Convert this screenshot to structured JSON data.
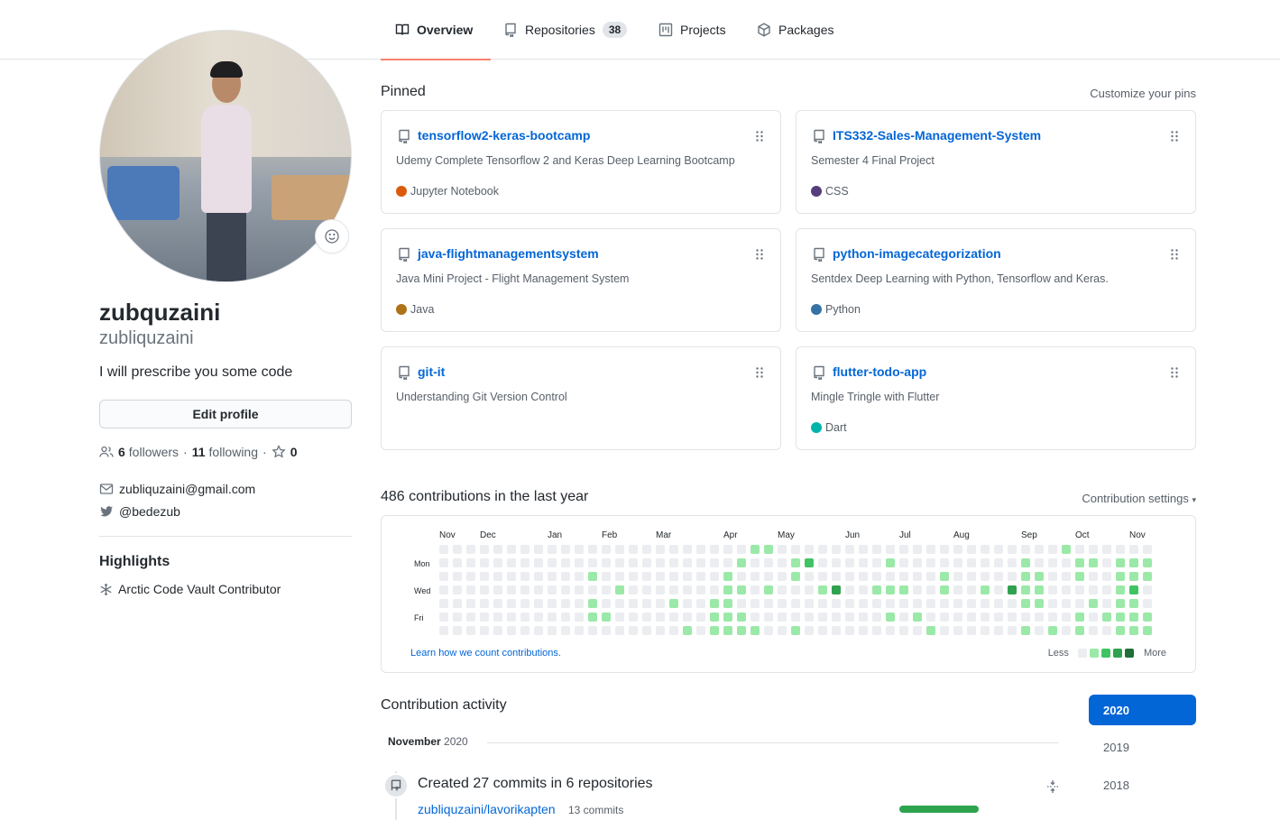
{
  "tabs": [
    {
      "label": "Overview",
      "icon": "book-icon",
      "active": true
    },
    {
      "label": "Repositories",
      "icon": "repo-icon",
      "count": "38"
    },
    {
      "label": "Projects",
      "icon": "project-icon"
    },
    {
      "label": "Packages",
      "icon": "package-icon"
    }
  ],
  "profile": {
    "name": "zubquzaini",
    "login": "zubliquzaini",
    "bio": "I will prescribe you some code",
    "edit_label": "Edit profile",
    "followers_count": "6",
    "followers_label": "followers",
    "following_count": "11",
    "following_label": "following",
    "stars_count": "0",
    "email": "zubliquzaini@gmail.com",
    "twitter": "@bedezub",
    "highlights_title": "Highlights",
    "highlight_item": "Arctic Code Vault Contributor"
  },
  "pinned": {
    "title": "Pinned",
    "customize_label": "Customize your pins",
    "repos": [
      {
        "name": "tensorflow2-keras-bootcamp",
        "description": "Udemy Complete Tensorflow 2 and Keras Deep Learning Bootcamp",
        "language": "Jupyter Notebook",
        "language_color": "#DA5B0B"
      },
      {
        "name": "ITS332-Sales-Management-System",
        "description": "Semester 4 Final Project",
        "language": "CSS",
        "language_color": "#563d7c"
      },
      {
        "name": "java-flightmanagementsystem",
        "description": "Java Mini Project - Flight Management System",
        "language": "Java",
        "language_color": "#b07219"
      },
      {
        "name": "python-imagecategorization",
        "description": "Sentdex Deep Learning with Python, Tensorflow and Keras.",
        "language": "Python",
        "language_color": "#3572A5"
      },
      {
        "name": "git-it",
        "description": "Understanding Git Version Control",
        "language": "",
        "language_color": ""
      },
      {
        "name": "flutter-todo-app",
        "description": "Mingle Tringle with Flutter",
        "language": "Dart",
        "language_color": "#00B4AB"
      }
    ]
  },
  "contributions": {
    "title": "486 contributions in the last year",
    "settings_label": "Contribution settings",
    "months": [
      "Nov",
      "Dec",
      "Jan",
      "Feb",
      "Mar",
      "Apr",
      "May",
      "Jun",
      "Jul",
      "Aug",
      "Sep",
      "Oct",
      "Nov"
    ],
    "month_weeks": [
      0,
      3,
      8,
      12,
      16,
      21,
      25,
      30,
      34,
      38,
      43,
      47,
      51
    ],
    "day_labels": [
      "Mon",
      "Wed",
      "Fri"
    ],
    "learn_label": "Learn how we count contributions.",
    "less_label": "Less",
    "more_label": "More",
    "level_colors": [
      "#ebedf0",
      "#9be9a8",
      "#40c463",
      "#30a14e",
      "#216e39"
    ],
    "weeks": [
      "0000000",
      "0000000",
      "0000000",
      "0000000",
      "0000000",
      "0000000",
      "0000000",
      "0000000",
      "0000000",
      "0000100",
      "0002000",
      "0000010",
      "0000200",
      "0000000",
      "0000000",
      "0000000",
      "0000000",
      "0000100",
      "0000010",
      "0000000",
      "0000000",
      "0010000",
      "0001100",
      "0002000",
      "0011000",
      "0000000",
      "0000000",
      "0000000",
      "0000000",
      "0001000",
      "0000100",
      "0000000",
      "0000000",
      "0001000",
      "0001100",
      "0000000",
      "0000000",
      "0001001",
      "0010010",
      "0000000",
      "0011000",
      "0000000",
      "0000000",
      "0000000",
      "0000000",
      "0000000",
      "0000000",
      "0000000",
      "0000000",
      "0000100",
      "0001000",
      "0002000",
      "0020000",
      "0000000",
      "0000000",
      "0000000",
      "0000000",
      "0000010",
      "0010010",
      "0001000",
      "0000000",
      "0001010",
      "0000000",
      "0010000",
      "0000000",
      "0000001",
      "0000000",
      "0000000",
      "0001000",
      "0000000",
      "0000100",
      "0000000",
      "0000000",
      "0000000",
      "0000010",
      "0000000",
      "0000000",
      "0001000",
      "0000000",
      "0000000",
      "0000000",
      "0000000",
      "0000000",
      "0000000",
      "0000000",
      "0000000",
      "0000000",
      "0000000",
      "0000000",
      "0000000",
      "0000000",
      "0000000",
      "0000000",
      "0000000",
      "0000000",
      "0000000",
      "0000000",
      "0000000",
      "0000000",
      "0000000",
      "0000000",
      "0000000",
      "0000000",
      "0000000",
      "0000000",
      "0000000",
      "0000000",
      "0000000",
      "0000000",
      "0000000",
      "0000000",
      "0000000",
      "0000000",
      "0000000",
      "0000000",
      "0000000",
      "0000000",
      "0000000",
      "0000000",
      "0000000",
      "0000000",
      "0000000",
      "0000000",
      "0000000",
      "0000000",
      "0000000",
      "0000000",
      "0000000",
      "0000000",
      "0000000",
      "0000000",
      "0000000",
      "0000000",
      "0000000",
      "0000000",
      "0000000",
      "0000000",
      "0000000",
      "0000000",
      "0000000",
      "0000000",
      "0000000",
      "0000000",
      "0000000",
      "0000000",
      "0000000",
      "0000000",
      "0000000",
      "0000000",
      "0000000",
      "0000000",
      "0000000",
      "0000000",
      "0000000",
      "0000000",
      "0000000",
      "0000000",
      "0000000",
      "0000000",
      "0000000",
      "0000000",
      "0000000",
      "0000000",
      "0000000",
      "0000000",
      "0000000",
      "0000000",
      "0000000",
      "0000000",
      "0000000",
      "0000000",
      "0000000",
      "0000000",
      "0000000",
      "0000000",
      "0000000",
      "0000000",
      "0000000",
      "0000000",
      "0000000",
      "0000000",
      "0000000",
      "0000000",
      "0000000",
      "0000000",
      "0000000",
      "0000000",
      "0000000",
      "0000000",
      "0000000",
      "0000000",
      "0000000",
      "0000000",
      "0000000",
      "0000000",
      "0000000",
      "0000000",
      "0000000",
      "0000000",
      "0000000",
      "0000000",
      "0000000",
      "0000000",
      "0000000",
      "0000000",
      "0000000",
      "0000000",
      "0000000",
      "0000000",
      "0000000",
      "0000000",
      "0000000",
      "0000000",
      "0000000",
      "0000000",
      "0000000",
      "0000000",
      "0000000",
      "0000000",
      "0000000",
      "0000000",
      "0000000",
      "0000000",
      "0000000",
      "0000000",
      "0000000",
      "0000000",
      "0000000",
      "0000000",
      "0000000",
      "0000000",
      "0000000",
      "0000000",
      "0000000",
      "0000000",
      "0000000",
      "0000000",
      "0000000",
      "0000000",
      "0000000",
      "0000000",
      "0000000",
      "0000000",
      "0000000",
      "0000000",
      "0000000",
      "0000000",
      "0000000",
      "0000000",
      "0000000",
      "0000000",
      "0000000",
      "0000000",
      "0000000",
      "0000000",
      "0000000",
      "0000000",
      "0000000",
      "0000000",
      "0000000",
      "0000000",
      "0000000",
      "0000000",
      "0000000",
      "0000000",
      "0000000",
      "0000000",
      "0000000",
      "0000000",
      "0000000",
      "0000000",
      "0000000",
      "0000000",
      "0000000",
      "0000000",
      "0000000",
      "0000000",
      "0000000",
      "0000000",
      "0000000"
    ]
  },
  "activity": {
    "title": "Contribution activity",
    "month": "November",
    "month_year": "2020",
    "commit_summary": "Created 27 commits in 6 repositories",
    "commit_repo": "zubliquzaini/lavorikapten",
    "commit_count": "13 commits",
    "commit_fraction": 0.48,
    "years": [
      "2020",
      "2019",
      "2018"
    ]
  }
}
